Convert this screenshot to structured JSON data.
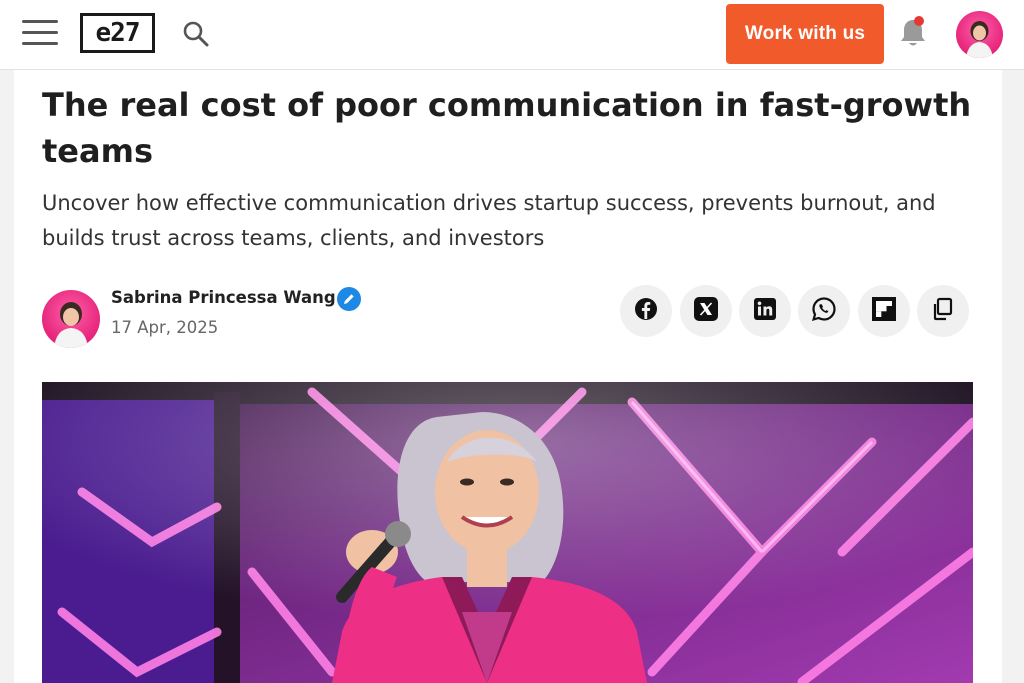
{
  "header": {
    "logo_text": "e27",
    "cta_label": "Work with us",
    "cta_color": "#f15a2b",
    "menu_icon": "hamburger-menu-icon",
    "search_icon": "search-icon",
    "bell_icon": "bell-icon",
    "notification_dot_color": "#e53935"
  },
  "article": {
    "title": "The real cost of poor communication in fast-growth teams",
    "subtitle": "Uncover how effective communication drives startup success, prevents burnout, and builds trust across teams, clients, and investors",
    "author": {
      "name": "Sabrina Princessa Wang",
      "verified_icon": "verified-pencil-icon",
      "date": "17 Apr, 2025"
    },
    "share_buttons": [
      {
        "icon": "facebook-icon"
      },
      {
        "icon": "x-twitter-icon"
      },
      {
        "icon": "linkedin-icon"
      },
      {
        "icon": "whatsapp-icon"
      },
      {
        "icon": "flipboard-icon"
      },
      {
        "icon": "copy-link-icon"
      }
    ],
    "hero_image": "speaker-on-stage-photo"
  }
}
